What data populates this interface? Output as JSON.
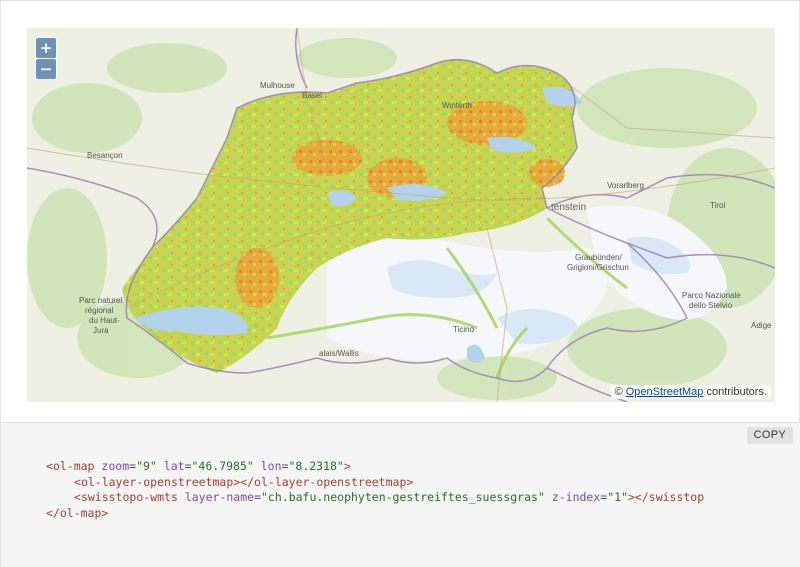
{
  "map": {
    "zoom_in_label": "+",
    "zoom_out_label": "−",
    "attribution": {
      "prefix": "©",
      "link_text": "OpenStreetMap",
      "suffix": "contributors."
    },
    "place_labels": [
      "Mulhouse",
      "Basel",
      "Winterth",
      "Besançon",
      "Vorarlberg",
      "tenstein",
      "Tirol",
      "Graubünden/",
      "Grigioni/Grischun",
      "Parc naturel",
      "régional",
      "du Haut-",
      "Jura",
      "Parco Nazionale",
      "dello Stelvio",
      "Adige",
      "Ticino",
      "alais/Wallis"
    ],
    "colors": {
      "land": "#eef0e4",
      "forest": "#cfe3b6",
      "water": "#b3d3ec",
      "overlay_low": "#a8d85a",
      "overlay_mid": "#e6e23a",
      "overlay_high": "#f08a2c",
      "border": "#9b7fb5"
    }
  },
  "code": {
    "copy_label": "COPY",
    "line1": {
      "tag": "ol-map",
      "attrs": [
        {
          "name": "zoom",
          "value": "\"9\""
        },
        {
          "name": "lat",
          "value": "\"46.7985\""
        },
        {
          "name": "lon",
          "value": "\"8.2318\""
        }
      ]
    },
    "line2": {
      "tag": "ol-layer-openstreetmap"
    },
    "line3": {
      "tag": "swisstopo-wmts",
      "attrs": [
        {
          "name": "layer-name",
          "value": "\"ch.bafu.neophyten-gestreiftes_suessgras\""
        },
        {
          "name": "z-index",
          "value": "\"1\""
        }
      ],
      "close_text": "></swisstop"
    },
    "line4": {
      "close": "</ol-map>"
    }
  }
}
